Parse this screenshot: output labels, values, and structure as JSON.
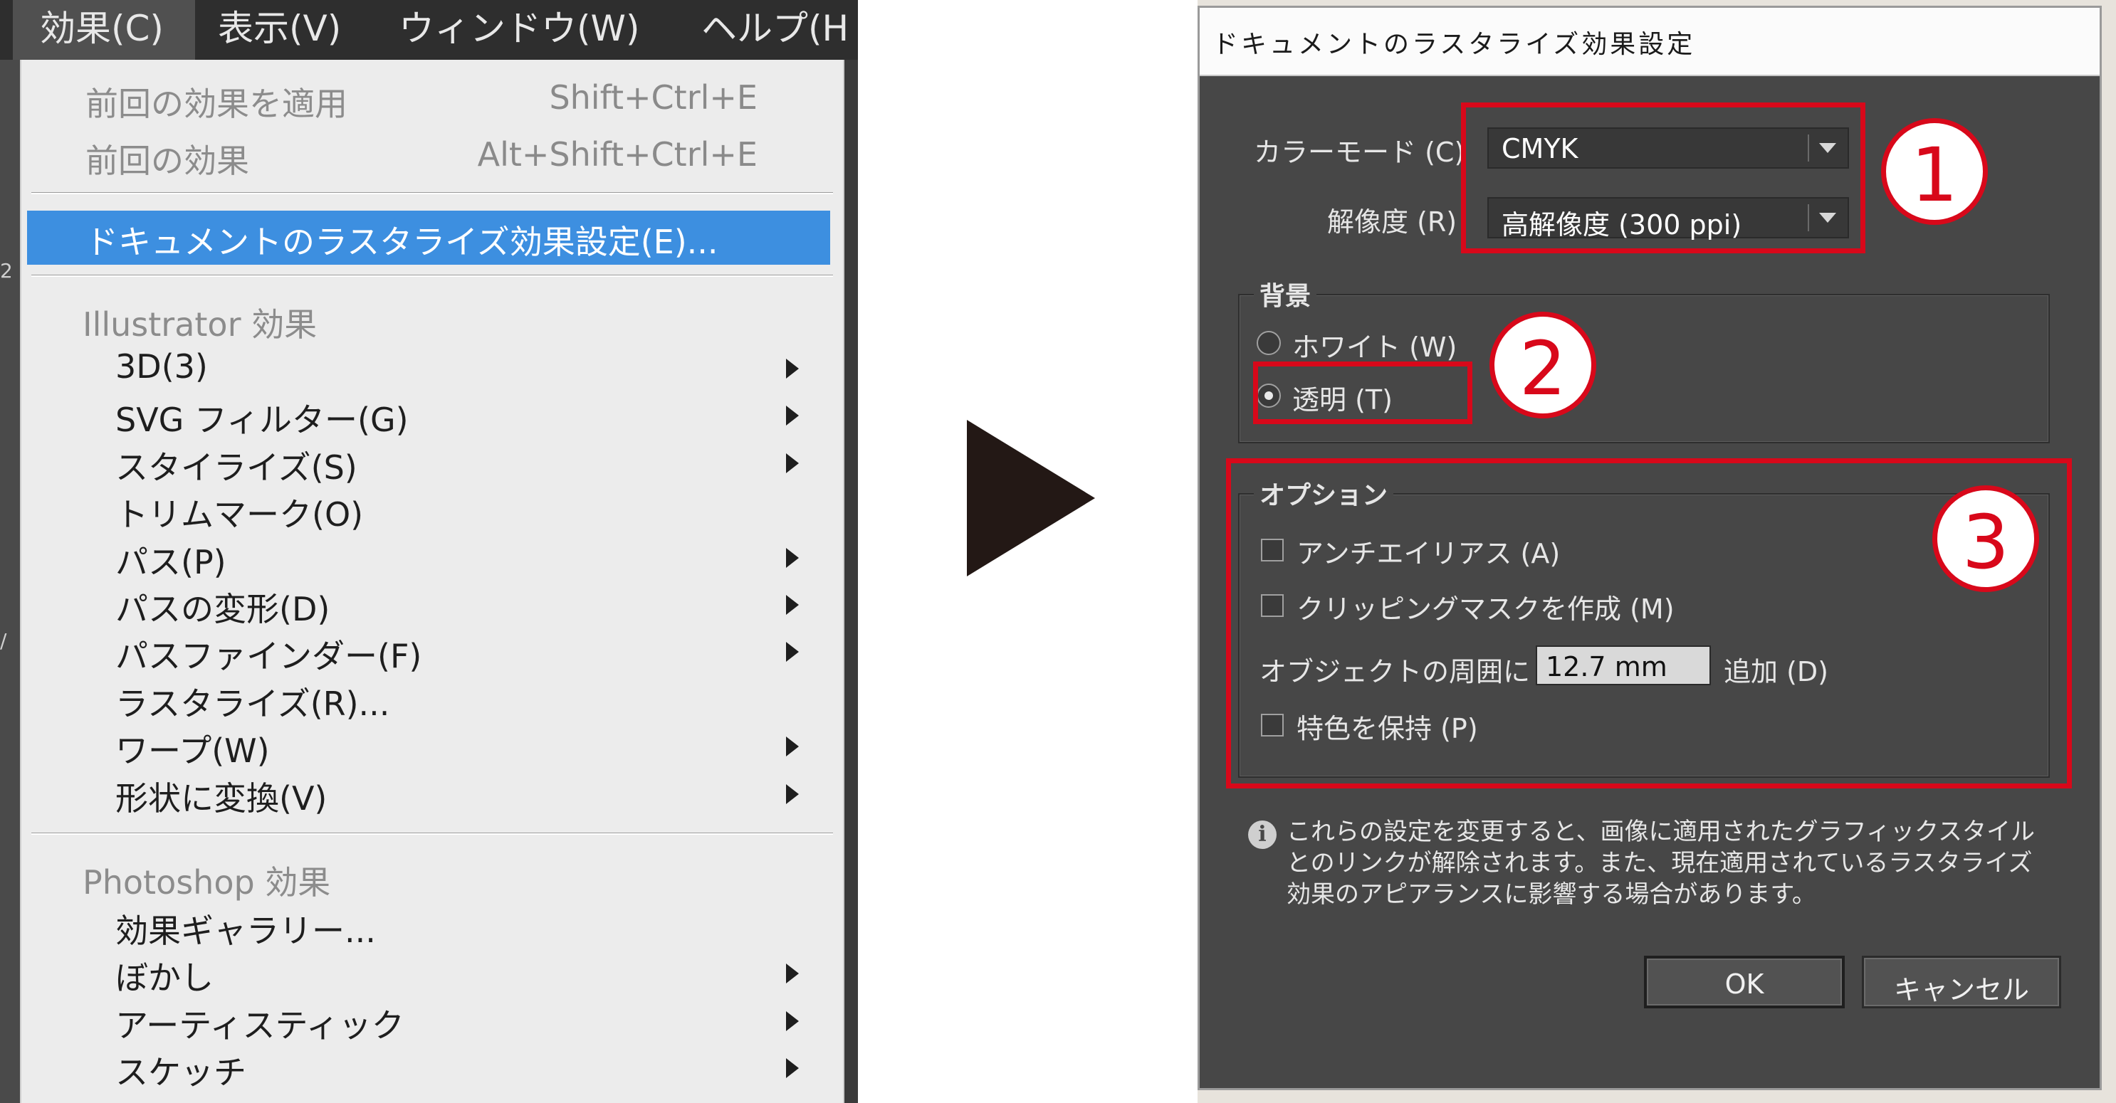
{
  "menubar": {
    "items": [
      {
        "label": "効果(C)",
        "active": true
      },
      {
        "label": "表示(V)"
      },
      {
        "label": "ウィンドウ(W)"
      },
      {
        "label": "ヘルプ(H"
      }
    ]
  },
  "background_marks": {
    "m1": "2",
    "m2": "/"
  },
  "effect_menu": {
    "apply_last": {
      "label": "前回の効果を適用",
      "shortcut": "Shift+Ctrl+E"
    },
    "last_effect": {
      "label": "前回の効果",
      "shortcut": "Alt+Shift+Ctrl+E"
    },
    "raster_settings": {
      "label": "ドキュメントのラスタライズ効果設定(E)..."
    },
    "illustrator_header": "Illustrator 効果",
    "illustrator_items": [
      {
        "label": "3D(3)",
        "submenu": true
      },
      {
        "label": "SVG フィルター(G)",
        "submenu": true
      },
      {
        "label": "スタイライズ(S)",
        "submenu": true
      },
      {
        "label": "トリムマーク(O)",
        "submenu": false
      },
      {
        "label": "パス(P)",
        "submenu": true
      },
      {
        "label": "パスの変形(D)",
        "submenu": true
      },
      {
        "label": "パスファインダー(F)",
        "submenu": true
      },
      {
        "label": "ラスタライズ(R)...",
        "submenu": false
      },
      {
        "label": "ワープ(W)",
        "submenu": true
      },
      {
        "label": "形状に変換(V)",
        "submenu": true
      }
    ],
    "photoshop_header": "Photoshop 効果",
    "photoshop_items": [
      {
        "label": "効果ギャラリー...",
        "submenu": false
      },
      {
        "label": "ぼかし",
        "submenu": true
      },
      {
        "label": "アーティスティック",
        "submenu": true
      },
      {
        "label": "スケッチ",
        "submenu": true
      }
    ]
  },
  "dialog": {
    "title": "ドキュメントのラスタライズ効果設定",
    "color_mode": {
      "label": "カラーモード (C)",
      "value": "CMYK"
    },
    "resolution": {
      "label": "解像度 (R)",
      "value": "高解像度 (300 ppi)"
    },
    "background": {
      "title": "背景",
      "white": {
        "label": "ホワイト (W)",
        "checked": false
      },
      "transparent": {
        "label": "透明 (T)",
        "checked": true
      }
    },
    "options": {
      "title": "オプション",
      "antialias": {
        "label": "アンチエイリアス (A)",
        "checked": false
      },
      "clipping_mask": {
        "label": "クリッピングマスクを作成 (M)",
        "checked": false
      },
      "add_around_label": "オブジェクトの周囲に",
      "add_around_value": "12.7 mm",
      "add_around_suffix": "追加 (D)",
      "spot_colors": {
        "label": "特色を保持 (P)",
        "checked": false
      }
    },
    "info": {
      "icon": "info-icon",
      "line1": "これらの設定を変更すると、画像に適用されたグラフィックスタイル",
      "line2": "とのリンクが解除されます。また、現在適用されているラスタライズ",
      "line3": "効果のアピアランスに影響する場合があります。"
    },
    "ok_label": "OK",
    "cancel_label": "キャンセル"
  },
  "annotations": {
    "badge1": "1",
    "badge2": "2",
    "badge3": "3",
    "color": "#d8081a"
  },
  "colors": {
    "menu_highlight": "#3d8fe0",
    "dialog_bg": "#474747",
    "arrow": "#231815"
  }
}
